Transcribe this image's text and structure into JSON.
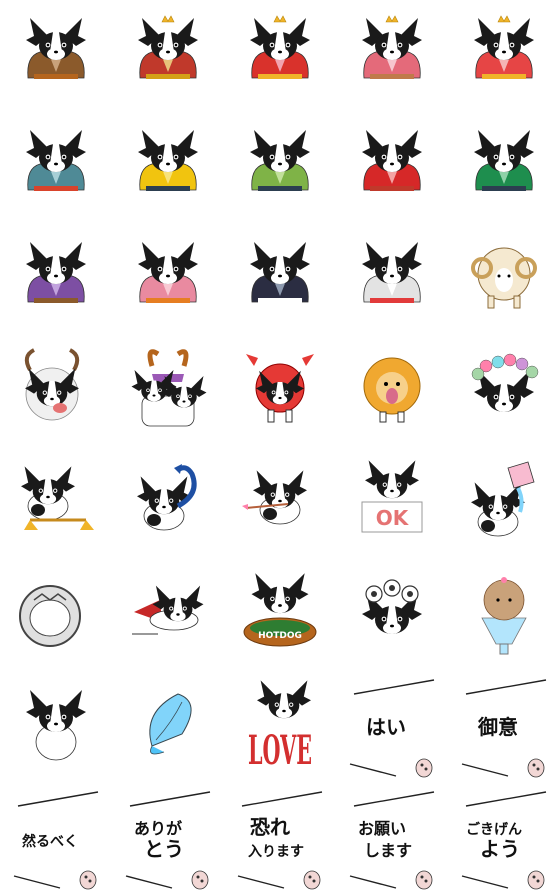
{
  "sheet": {
    "columns": 5,
    "rows": 8,
    "stickers": [
      {
        "row": 0,
        "col": 0,
        "kind": "hina",
        "robe": "#8b5a2b",
        "robe2": "#c9a27a",
        "accent": "#b5651d",
        "crown": false,
        "icon": "papillon-hina-brown-robe-icon"
      },
      {
        "row": 0,
        "col": 1,
        "kind": "hina",
        "robe": "#c0392b",
        "robe2": "#e8c27a",
        "accent": "#d4a017",
        "crown": true,
        "icon": "papillon-hina-emperor-icon"
      },
      {
        "row": 0,
        "col": 2,
        "kind": "hina",
        "robe": "#d9322c",
        "robe2": "#f2a3b0",
        "accent": "#f0b429",
        "crown": true,
        "icon": "papillon-hina-empress-icon"
      },
      {
        "row": 0,
        "col": 3,
        "kind": "hina",
        "robe": "#e46a7a",
        "robe2": "#f7c6cf",
        "accent": "#c07a4a",
        "crown": true,
        "icon": "papillon-hina-lady-icon"
      },
      {
        "row": 0,
        "col": 4,
        "kind": "hina",
        "robe": "#e64545",
        "robe2": "#f5b5b5",
        "accent": "#f0b429",
        "crown": true,
        "icon": "papillon-hina-lady-fan-icon"
      },
      {
        "row": 1,
        "col": 0,
        "kind": "hina",
        "robe": "#4f8a96",
        "robe2": "#a7cfd6",
        "accent": "#d9432b",
        "crown": false,
        "icon": "papillon-koto-player-icon"
      },
      {
        "row": 1,
        "col": 1,
        "kind": "hina",
        "robe": "#f1c40f",
        "robe2": "#f7e27a",
        "accent": "#2c3e50",
        "crown": false,
        "icon": "papillon-musician-yellow-icon"
      },
      {
        "row": 1,
        "col": 2,
        "kind": "hina",
        "robe": "#7fb347",
        "robe2": "#c2e09a",
        "accent": "#2c3e50",
        "crown": false,
        "icon": "papillon-musician-green-icon"
      },
      {
        "row": 1,
        "col": 3,
        "kind": "hina",
        "robe": "#d62828",
        "robe2": "#f3a3a3",
        "accent": "#c0392b",
        "crown": false,
        "icon": "papillon-shamisen-icon"
      },
      {
        "row": 1,
        "col": 4,
        "kind": "hina",
        "robe": "#1e8e4e",
        "robe2": "#8fd1a8",
        "accent": "#2c3e50",
        "crown": false,
        "icon": "papillon-musician-teal-icon"
      },
      {
        "row": 2,
        "col": 0,
        "kind": "hina",
        "robe": "#7d4fa3",
        "robe2": "#c2a3de",
        "accent": "#8b5a2b",
        "crown": false,
        "icon": "papillon-flute-player-icon"
      },
      {
        "row": 2,
        "col": 1,
        "kind": "hina",
        "robe": "#e98aa0",
        "robe2": "#f8c9d3",
        "accent": "#e67e22",
        "crown": false,
        "icon": "papillon-drum-player-icon"
      },
      {
        "row": 2,
        "col": 2,
        "kind": "hina",
        "robe": "#2b2d42",
        "robe2": "#8d99ae",
        "accent": "#ffffff",
        "crown": false,
        "icon": "papillon-black-kimono-icon"
      },
      {
        "row": 2,
        "col": 3,
        "kind": "hina",
        "robe": "#e3e3e3",
        "robe2": "#ffffff",
        "accent": "#e23b3b",
        "crown": false,
        "icon": "papillon-white-kimono-icon"
      },
      {
        "row": 2,
        "col": 4,
        "kind": "ram",
        "icon": "papillon-aries-ram-icon"
      },
      {
        "row": 3,
        "col": 0,
        "kind": "bull",
        "icon": "papillon-taurus-mask-icon"
      },
      {
        "row": 3,
        "col": 1,
        "kind": "twins",
        "icon": "papillon-gemini-twins-icon"
      },
      {
        "row": 3,
        "col": 2,
        "kind": "crab",
        "icon": "papillon-cancer-crab-icon"
      },
      {
        "row": 3,
        "col": 3,
        "kind": "lion",
        "icon": "papillon-leo-lion-icon"
      },
      {
        "row": 3,
        "col": 4,
        "kind": "flowers",
        "icon": "papillon-virgo-flower-crown-icon"
      },
      {
        "row": 4,
        "col": 0,
        "kind": "scales",
        "icon": "papillon-libra-scales-icon"
      },
      {
        "row": 4,
        "col": 1,
        "kind": "scorpion",
        "icon": "papillon-scorpio-tail-icon"
      },
      {
        "row": 4,
        "col": 2,
        "kind": "archer",
        "icon": "papillon-sagittarius-arrow-icon"
      },
      {
        "row": 4,
        "col": 3,
        "kind": "okboard",
        "text": "OK",
        "icon": "papillon-ok-board-icon"
      },
      {
        "row": 4,
        "col": 4,
        "kind": "water",
        "icon": "papillon-aquarius-jar-icon"
      },
      {
        "row": 5,
        "col": 0,
        "kind": "helmet",
        "icon": "papillon-astronaut-helmet-icon"
      },
      {
        "row": 5,
        "col": 1,
        "kind": "cape",
        "icon": "papillon-flying-cape-icon"
      },
      {
        "row": 5,
        "col": 2,
        "kind": "hotdog",
        "text": "HOTDOG",
        "icon": "papillon-hotdog-icon"
      },
      {
        "row": 5,
        "col": 3,
        "kind": "curlers",
        "icon": "papillon-hair-curlers-icon"
      },
      {
        "row": 5,
        "col": 4,
        "kind": "parfait",
        "icon": "papillon-parfait-cup-icon"
      },
      {
        "row": 6,
        "col": 0,
        "kind": "sitting",
        "icon": "papillon-sitting-back-icon"
      },
      {
        "row": 6,
        "col": 1,
        "kind": "butterfly",
        "icon": "blue-butterfly-wing-icon"
      },
      {
        "row": 6,
        "col": 2,
        "kind": "love",
        "text": "LOVE",
        "icon": "papillon-love-letters-icon"
      },
      {
        "row": 6,
        "col": 3,
        "kind": "text",
        "lines": [
          "はい"
        ],
        "icon": "paw-peek-text-icon"
      },
      {
        "row": 6,
        "col": 4,
        "kind": "text",
        "lines": [
          "御意"
        ],
        "icon": "paw-peek-text-icon"
      },
      {
        "row": 7,
        "col": 0,
        "kind": "text",
        "lines": [
          "然るべく"
        ],
        "icon": "paw-peek-text-icon"
      },
      {
        "row": 7,
        "col": 1,
        "kind": "text",
        "lines": [
          "ありが",
          "とう"
        ],
        "icon": "paw-peek-text-icon"
      },
      {
        "row": 7,
        "col": 2,
        "kind": "text",
        "lines": [
          "恐れ",
          "入ります"
        ],
        "icon": "paw-peek-text-icon"
      },
      {
        "row": 7,
        "col": 3,
        "kind": "text",
        "lines": [
          "お願い",
          "します"
        ],
        "icon": "paw-peek-text-icon"
      },
      {
        "row": 7,
        "col": 4,
        "kind": "text",
        "lines": [
          "ごきげん",
          "よう"
        ],
        "icon": "paw-peek-text-icon"
      }
    ]
  }
}
